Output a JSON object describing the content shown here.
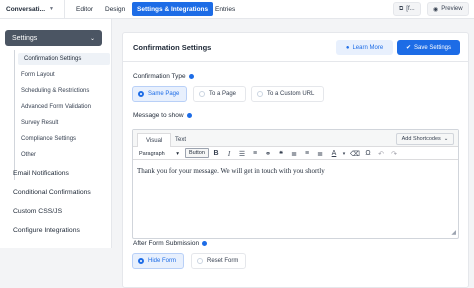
{
  "topbar": {
    "form_name": "Conversati...",
    "tabs": [
      "Editor",
      "Design",
      "Settings & Integrations",
      "Entries"
    ],
    "active_tab": "Settings & Integrations",
    "shortcode_label": "[f...",
    "preview_label": "Preview"
  },
  "sidebar": {
    "section_label": "Settings",
    "sub_items": [
      "Confirmation Settings",
      "Form Layout",
      "Scheduling & Restrictions",
      "Advanced Form Validation",
      "Survey Result",
      "Compliance Settings",
      "Other"
    ],
    "active_sub_item": "Confirmation Settings",
    "main_items": [
      "Email Notifications",
      "Conditional Confirmations",
      "Custom CSS/JS",
      "Configure Integrations"
    ]
  },
  "card": {
    "title": "Confirmation Settings",
    "learn_more_label": "Learn More",
    "save_label": "Save Settings",
    "confirmation_type": {
      "label": "Confirmation Type",
      "options": [
        "Same Page",
        "To a Page",
        "To a Custom URL"
      ],
      "selected": "Same Page"
    },
    "message": {
      "label": "Message to show",
      "tabs": [
        "Visual",
        "Text"
      ],
      "active_tab": "Visual",
      "add_shortcodes_label": "Add Shortcodes",
      "format_select": "Paragraph",
      "button_label": "Button",
      "toolbar_icons": [
        "bold-icon",
        "italic-icon",
        "bullet-list-icon",
        "numbered-list-icon",
        "link-icon",
        "blockquote-icon",
        "align-left-icon",
        "align-center-icon",
        "align-right-icon",
        "text-color-icon",
        "clear-format-icon",
        "undo-icon",
        "redo-icon"
      ],
      "content": "Thank you for your message. We will get in touch with you shortly"
    },
    "after_submission": {
      "label": "After Form Submission",
      "options": [
        "Hide Form",
        "Reset Form"
      ],
      "selected": "Hide Form"
    }
  },
  "colors": {
    "accent": "#1d6ce6",
    "sidebar_active": "#4b5563"
  }
}
